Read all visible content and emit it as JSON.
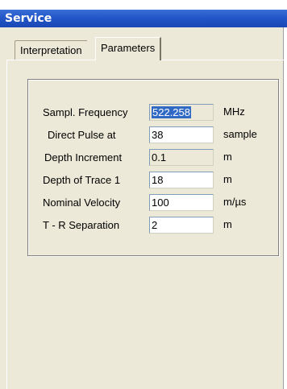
{
  "window": {
    "title": "Service"
  },
  "tabs": [
    {
      "label": "Interpretation",
      "active": false
    },
    {
      "label": "Parameters",
      "active": true
    }
  ],
  "parameters": [
    {
      "label": "Sampl. Frequency",
      "value": "522.258",
      "unit": "MHz",
      "editable": false,
      "selected": true
    },
    {
      "label": "Direct Pulse at",
      "value": "38",
      "unit": "sample",
      "editable": true,
      "selected": false
    },
    {
      "label": "Depth Increment",
      "value": "0.1",
      "unit": "m",
      "editable": false,
      "selected": false
    },
    {
      "label": "Depth of Trace 1",
      "value": "18",
      "unit": "m",
      "editable": true,
      "selected": false
    },
    {
      "label": "Nominal Velocity",
      "value": "100",
      "unit": "m/µs",
      "editable": true,
      "selected": false
    },
    {
      "label": "T - R Separation",
      "value": "2",
      "unit": "m",
      "editable": true,
      "selected": false
    }
  ]
}
